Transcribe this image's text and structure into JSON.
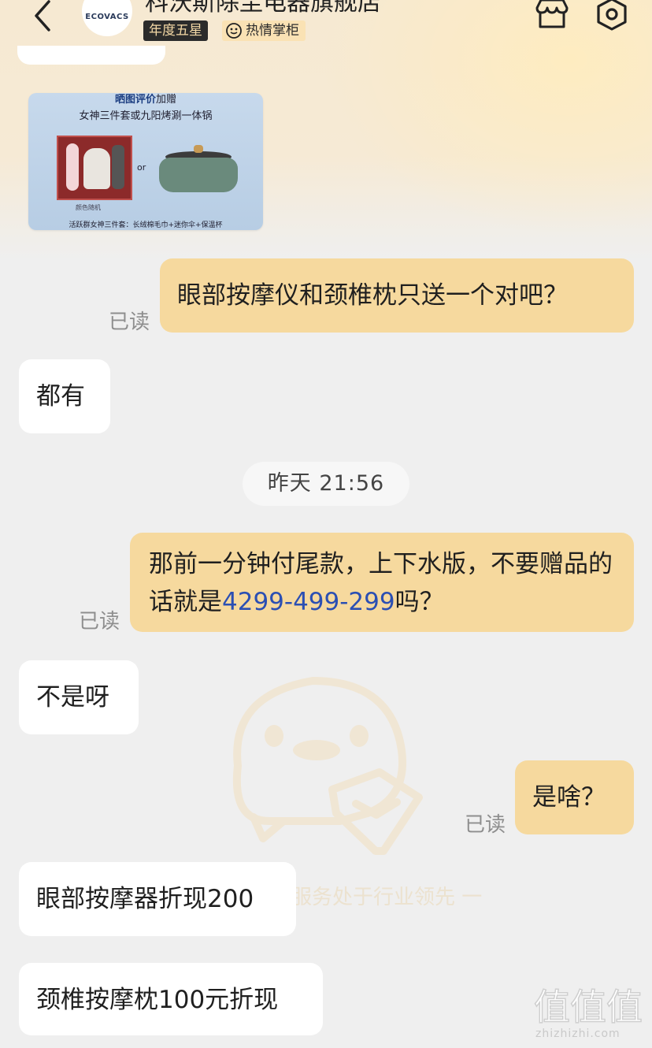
{
  "header": {
    "shop_name": "科沃斯除尘电器旗舰店",
    "logo_text": "ECOVACS",
    "badge_star": "年度五星",
    "badge_host": "热情掌柜"
  },
  "promo": {
    "title_highlight": "晒图评价",
    "title_rest": "加赠",
    "subtitle": "女神三件套或九阳烤涮一体锅",
    "or_text": "or",
    "color_note": "颜色随机",
    "footer": "活跃群女神三件套：长绒棉毛巾+迷你伞+保温杯"
  },
  "messages": {
    "m1": "眼部按摩仪和颈椎枕只送一个对吧？",
    "m1_read": "已读",
    "m2": "都有",
    "time": "昨天  21:56",
    "m3_a": "那前一分钟付尾款，上下水版，不要赠品的话就是",
    "m3_num": "4299-499-299",
    "m3_b": "吗？",
    "m3_read": "已读",
    "m4": "不是呀",
    "m5": "是啥？",
    "m5_read": "已读",
    "m6": "眼部按摩器折现200",
    "m7": "颈椎按摩枕100元折现"
  },
  "watermark_text": "服务处于行业领先  一",
  "site": {
    "logo": "值值值",
    "url": "zhizhizhi.com"
  },
  "colors": {
    "outgoing_bubble": "#f6d99e",
    "incoming_bubble": "#ffffff",
    "link_number": "#2b4fb3",
    "background": "#efefef"
  }
}
